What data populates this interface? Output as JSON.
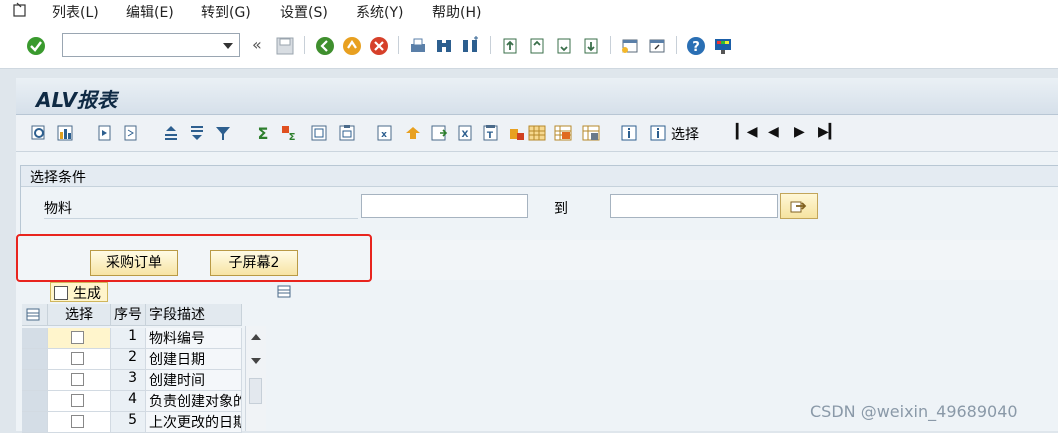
{
  "menubar": {
    "items": [
      "列表(L)",
      "编辑(E)",
      "转到(G)",
      "设置(S)",
      "系统(Y)",
      "帮助(H)"
    ]
  },
  "system_toolbar": {
    "command_field_value": "",
    "back_label": "«"
  },
  "title": "ALV报表",
  "app_toolbar": {
    "select_label": "选择"
  },
  "selection": {
    "group_title": "选择条件",
    "material_label": "物料",
    "to_label": "到",
    "material_from": "",
    "material_to": ""
  },
  "buttons": {
    "purchase_order": "采购订单",
    "subscreen2": "子屏幕2"
  },
  "grid": {
    "generate_label": "生成",
    "columns": [
      "选择",
      "序号",
      "字段描述"
    ],
    "rows": [
      {
        "no": "1",
        "desc": "物料编号"
      },
      {
        "no": "2",
        "desc": "创建日期"
      },
      {
        "no": "3",
        "desc": "创建时间"
      },
      {
        "no": "4",
        "desc": "负责创建对象的"
      },
      {
        "no": "5",
        "desc": "上次更改的日期"
      }
    ]
  },
  "watermark": "CSDN @weixin_49689040",
  "colors": {
    "button_yellow": "#f7e4a4",
    "highlight_red": "#e8241e",
    "title_blue": "#0f2a44"
  }
}
